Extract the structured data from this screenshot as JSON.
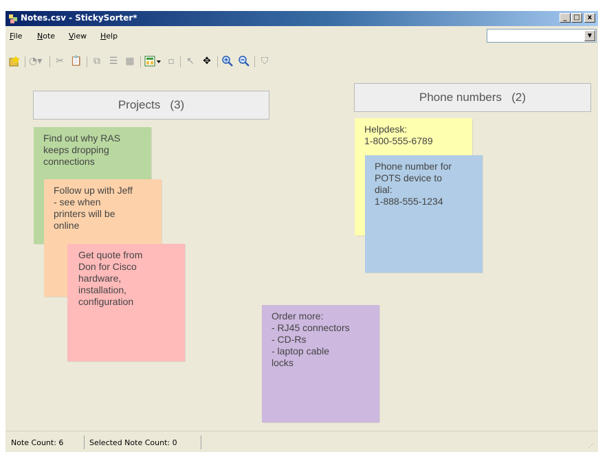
{
  "window": {
    "title": "Notes.csv - StickySorter*",
    "buttons": {
      "minimize": "_",
      "maximize": "□",
      "close": "x"
    }
  },
  "menu": {
    "items": [
      {
        "label": "File"
      },
      {
        "label": "Note"
      },
      {
        "label": "View"
      },
      {
        "label": "Help"
      }
    ],
    "combo_value": ""
  },
  "toolbar": {
    "icons": [
      "new-note-icon",
      "color-dropdown-icon",
      "cut-icon",
      "paste-icon",
      "copy-icon",
      "list-view-icon",
      "grid-view-icon",
      "group-dropdown-icon",
      "layout-icon",
      "pointer-icon",
      "move-icon",
      "zoom-in-icon",
      "zoom-out-icon",
      "filter-icon"
    ]
  },
  "groups": [
    {
      "label": "Projects",
      "count": "(3)"
    },
    {
      "label": "Phone numbers",
      "count": "(2)"
    }
  ],
  "notes": [
    {
      "text": "Find out why RAS\nkeeps dropping\nconnections",
      "color": "#b9d8a0"
    },
    {
      "text": "Follow up with Jeff\n- see when\nprinters will be\nonline",
      "color": "#fdd2aa"
    },
    {
      "text": "Get quote from\nDon for Cisco\nhardware,\ninstallation,\nconfiguration",
      "color": "#ffbaba"
    },
    {
      "text": "Helpdesk:\n1-800-555-6789",
      "color": "#ffffb0"
    },
    {
      "text": "Phone number for\nPOTS device to\ndial:\n1-888-555-1234",
      "color": "#b0cce6"
    },
    {
      "text": "Order more:\n- RJ45 connectors\n- CD-Rs\n- laptop cable\nlocks",
      "color": "#cdb8df"
    }
  ],
  "status": {
    "note_count": "Note Count: 6",
    "selected_note_count": "Selected Note Count: 0"
  }
}
